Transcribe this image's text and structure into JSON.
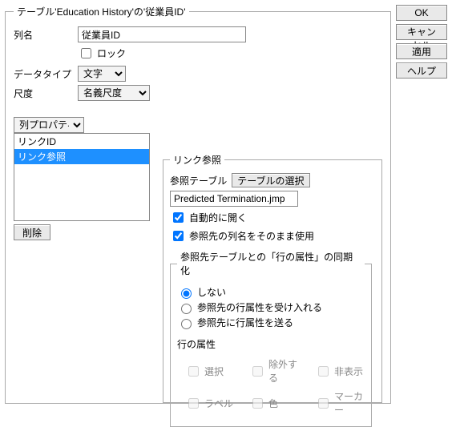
{
  "legend": "テーブル'Education History'の'従業員ID'",
  "labels": {
    "colname": "列名",
    "datatype": "データタイプ",
    "scale": "尺度",
    "lock": "ロック",
    "colprops": "列プロパティ",
    "delete": "削除"
  },
  "values": {
    "colname": "従業員ID",
    "datatype": "文字",
    "scale": "名義尺度",
    "lock": false
  },
  "proplist": {
    "items": [
      "リンクID",
      "リンク参照"
    ],
    "selectedIndex": 1
  },
  "linkref": {
    "legend": "リンク参照",
    "reftable_label": "参照テーブル",
    "select_table_btn": "テーブルの選択",
    "refpath": "Predicted Termination.jmp",
    "auto_open": {
      "label": "自動的に開く",
      "checked": true
    },
    "keep_colnames": {
      "label": "参照先の列名をそのまま使用",
      "checked": true
    },
    "sync": {
      "legend": "参照先テーブルとの「行の属性」の同期化",
      "options": [
        "しない",
        "参照先の行属性を受け入れる",
        "参照先に行属性を送る"
      ],
      "selectedIndex": 0,
      "rowattrs_label": "行の属性",
      "attrs": [
        "選択",
        "除外する",
        "非表示",
        "ラベル",
        "色",
        "マーカー"
      ]
    }
  },
  "buttons": {
    "ok": "OK",
    "cancel": "キャンセル",
    "apply": "適用",
    "help": "ヘルプ"
  }
}
